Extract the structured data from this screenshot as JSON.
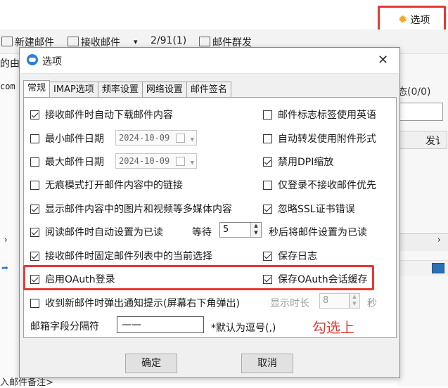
{
  "background": {
    "options_button": "选项",
    "toolbar": {
      "new_mail": "新建邮件",
      "receive_mail": "接收邮件",
      "dropdown_glyph": "▾",
      "count": "2/91(1)",
      "mass_mail": "邮件群发"
    },
    "left_fragment": "的由",
    "left_fragment2": "com",
    "right_fragment": "态(0/0)",
    "right_column": "发讠",
    "bottom_fragment": "入邮件备注>"
  },
  "dialog": {
    "title": "选项",
    "close_glyph": "✕",
    "tabs": [
      "常规",
      "IMAP选项",
      "频率设置",
      "网络设置",
      "邮件签名"
    ],
    "left_options": {
      "auto_download": {
        "label": "接收邮件时自动下载邮件内容",
        "checked": true
      },
      "min_date": {
        "label": "最小邮件日期",
        "checked": false,
        "value": "2024-10-09"
      },
      "max_date": {
        "label": "最大邮件日期",
        "checked": false,
        "value": "2024-10-09"
      },
      "incognito_links": {
        "label": "无痕模式打开邮件内容中的链接",
        "checked": false
      },
      "show_media": {
        "label": "显示邮件内容中的图片和视频等多媒体内容",
        "checked": true
      },
      "auto_mark_read": {
        "label": "阅读邮件时自动设置为已读",
        "checked": true
      },
      "fix_selection": {
        "label": "接收邮件时固定邮件列表中的当前选择",
        "checked": true
      },
      "enable_oauth": {
        "label": "启用OAuth登录",
        "checked": true
      },
      "popup_notify": {
        "label": "收到新邮件时弹出通知提示(屏幕右下角弹出)",
        "checked": false
      }
    },
    "right_options": {
      "english_flags": {
        "label": "邮件标志标签使用英语",
        "checked": false
      },
      "forward_attachment": {
        "label": "自动转发使用附件形式",
        "checked": false
      },
      "disable_dpi": {
        "label": "禁用DPI缩放",
        "checked": true
      },
      "unread_only": {
        "label": "仅登录不接收邮件优先",
        "checked": false
      },
      "ignore_ssl": {
        "label": "忽略SSL证书错误",
        "checked": true
      },
      "save_log": {
        "label": "保存日志",
        "checked": true
      },
      "save_oauth_cache": {
        "label": "保存OAuth会话缓存",
        "checked": true
      }
    },
    "wait": {
      "label": "等待",
      "value": "5",
      "suffix": "秒后将邮件设置为已读"
    },
    "display_duration": {
      "label": "显示时长",
      "value": "8",
      "suffix": "秒"
    },
    "separator": {
      "label": "邮箱字段分隔符",
      "value": "——",
      "hint": "*默认为逗号(,)"
    },
    "annotation": "勾选上",
    "ok_button": "确定",
    "cancel_button": "取消"
  },
  "colors": {
    "highlight_red": "#e53935",
    "title_icon_blue": "#2b7fe0",
    "gear_orange": "#f5a623"
  }
}
